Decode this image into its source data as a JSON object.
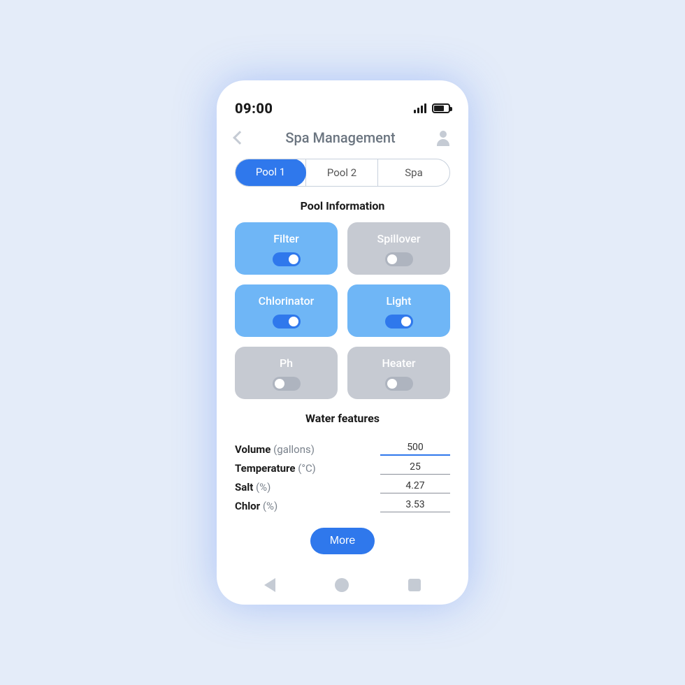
{
  "statusbar": {
    "time": "09:00"
  },
  "header": {
    "title": "Spa Management"
  },
  "tabs": [
    {
      "label": "Pool 1",
      "active": true
    },
    {
      "label": "Pool 2",
      "active": false
    },
    {
      "label": "Spa",
      "active": false
    }
  ],
  "sections": {
    "pool_info_title": "Pool Information",
    "water_features_title": "Water features"
  },
  "controls": [
    {
      "label": "Filter",
      "on": true
    },
    {
      "label": "Spillover",
      "on": false
    },
    {
      "label": "Chlorinator",
      "on": true
    },
    {
      "label": "Light",
      "on": true
    },
    {
      "label": "Ph",
      "on": false
    },
    {
      "label": "Heater",
      "on": false
    }
  ],
  "features": [
    {
      "name": "Volume",
      "unit": "(gallons)",
      "value": "500",
      "active": true
    },
    {
      "name": "Temperature",
      "unit": "(°C)",
      "value": "25",
      "active": false
    },
    {
      "name": "Salt",
      "unit": "(%)",
      "value": "4.27",
      "active": false
    },
    {
      "name": "Chlor",
      "unit": "(%)",
      "value": "3.53",
      "active": false
    }
  ],
  "more_label": "More"
}
